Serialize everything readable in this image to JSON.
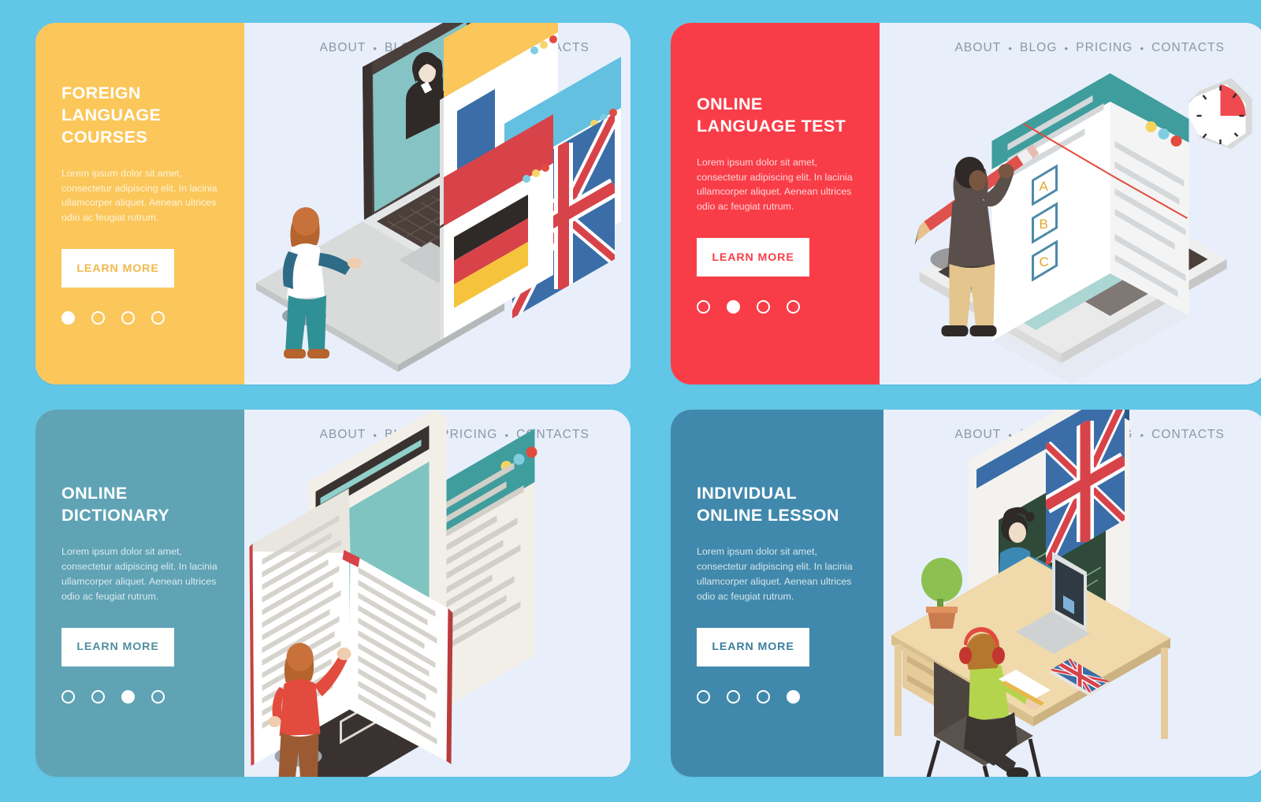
{
  "page": {
    "background_color": "#62c6e6",
    "panel_background_color": "#e8effa"
  },
  "nav": {
    "items": [
      "ABOUT",
      "BLOG",
      "PRICING",
      "CONTACTS"
    ],
    "separator": "•"
  },
  "banners": [
    {
      "id": "foreign-language-courses",
      "title": "FOREIGN LANGUAGE COURSES",
      "description": "Lorem ipsum dolor sit amet, consectetur adipiscing elit. In lacinia ullamcorper aliquet. Aenean ultrices odio ac feugiat rutrum.",
      "button_label": "LEARN MORE",
      "accent_color": "#fbc75a",
      "dots": 4,
      "active_dot": 1,
      "illustration": "laptop-teacher-flags"
    },
    {
      "id": "online-language-test",
      "title": "ONLINE LANGUAGE TEST",
      "description": "Lorem ipsum dolor sit amet, consectetur adipiscing elit. In lacinia ullamcorper aliquet. Aenean ultrices odio ac feugiat rutrum.",
      "button_label": "LEARN MORE",
      "accent_color": "#f93d48",
      "dots": 4,
      "active_dot": 2,
      "illustration": "tablet-test-clock",
      "test_options": [
        "A",
        "B",
        "C"
      ]
    },
    {
      "id": "online-dictionary",
      "title": "ONLINE DICTIONARY",
      "description": "Lorem ipsum dolor sit amet, consectetur adipiscing elit. In lacinia ullamcorper aliquet. Aenean ultrices odio ac feugiat rutrum.",
      "button_label": "LEARN MORE",
      "accent_color": "#5fa3b5",
      "dots": 4,
      "active_dot": 3,
      "illustration": "open-book-browser-window"
    },
    {
      "id": "individual-online-lesson",
      "title": "INDIVIDUAL ONLINE LESSON",
      "description": "Lorem ipsum dolor sit amet, consectetur adipiscing elit. In lacinia ullamcorper aliquet. Aenean ultrices odio ac feugiat rutrum.",
      "button_label": "LEARN MORE",
      "accent_color": "#4189ac",
      "dots": 4,
      "active_dot": 4,
      "illustration": "desk-student-video-lesson"
    }
  ]
}
